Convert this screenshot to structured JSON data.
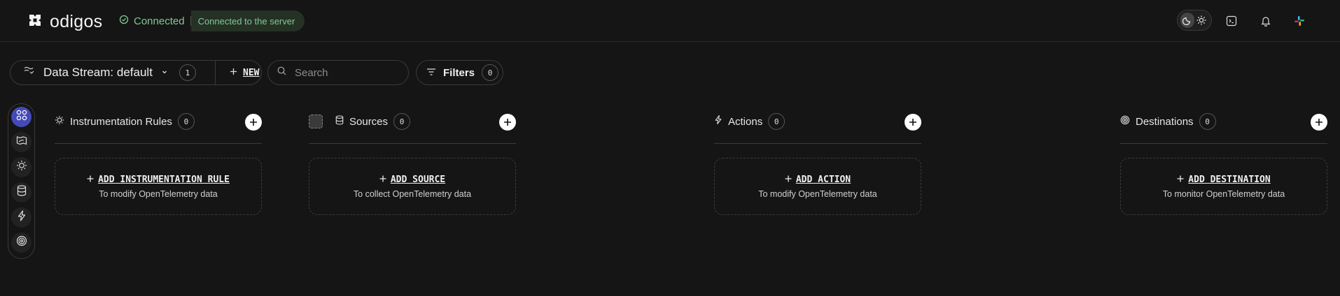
{
  "header": {
    "logo_text": "odigos",
    "status_label": "Connected",
    "status_message": "Connected to the server",
    "theme_options": [
      "moon-icon",
      "sun-icon"
    ],
    "icons": [
      "terminal-icon",
      "bell-icon",
      "slack-icon"
    ]
  },
  "toolbar": {
    "stream_label": "Data Stream: default",
    "stream_count": "1",
    "new_label": "NEW",
    "search_placeholder": "Search",
    "filters_label": "Filters",
    "filters_count": "0"
  },
  "sidenav": {
    "items": [
      "overview-icon",
      "map-icon",
      "instrumentation-icon",
      "sources-icon",
      "actions-icon",
      "destinations-icon"
    ]
  },
  "columns": [
    {
      "title": "Instrumentation Rules",
      "count": "0",
      "add_label": "ADD INSTRUMENTATION RULE",
      "subtitle": "To modify OpenTelemetry data"
    },
    {
      "title": "Sources",
      "count": "0",
      "add_label": "ADD SOURCE",
      "subtitle": "To collect OpenTelemetry data"
    },
    {
      "title": "Actions",
      "count": "0",
      "add_label": "ADD ACTION",
      "subtitle": "To modify OpenTelemetry data"
    },
    {
      "title": "Destinations",
      "count": "0",
      "add_label": "ADD DESTINATION",
      "subtitle": "To monitor OpenTelemetry data"
    }
  ],
  "colors": {
    "background": "#151515",
    "connected_green": "#81c995",
    "active_nav": "#444ab8"
  }
}
